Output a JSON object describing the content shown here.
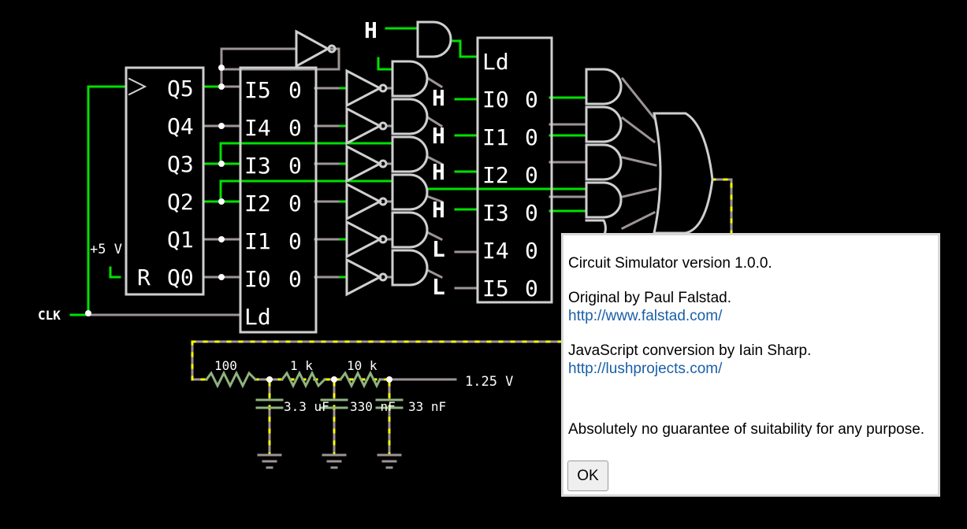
{
  "circuit": {
    "register1": {
      "outputs": [
        "Q5",
        "Q4",
        "Q3",
        "Q2",
        "Q1",
        "Q0"
      ],
      "reset": "R",
      "supply": "+5 V",
      "clock": "CLK"
    },
    "register2": {
      "inputs": [
        "I5",
        "I4",
        "I3",
        "I2",
        "I1",
        "I0"
      ],
      "outputs": [
        "0",
        "0",
        "0",
        "0",
        "0",
        "0"
      ],
      "load": "Ld"
    },
    "register3": {
      "inputs": [
        "I0",
        "I1",
        "I2",
        "I3",
        "I4",
        "I5"
      ],
      "outputs": [
        "0",
        "0",
        "0",
        "0",
        "0",
        "0"
      ],
      "load": "Ld"
    },
    "logic_inputs": [
      "H",
      "H",
      "H",
      "H",
      "L",
      "L"
    ],
    "load_input": "H",
    "filter": {
      "resistors": [
        "100",
        "1 k",
        "10 k"
      ],
      "capacitors": [
        "3.3 uF",
        "330 nF",
        "33 nF"
      ],
      "output": "1.25 V"
    }
  },
  "about_dialog": {
    "title_line": "Circuit Simulator version 1.0.0.",
    "original_by": "Original by Paul Falstad.",
    "original_link": "http://www.falstad.com/",
    "conversion_by": "JavaScript conversion by Iain Sharp.",
    "conversion_link": "http://lushprojects.com/",
    "disclaimer": "Absolutely no guarantee of suitability for any purpose.",
    "ok_label": "OK"
  }
}
